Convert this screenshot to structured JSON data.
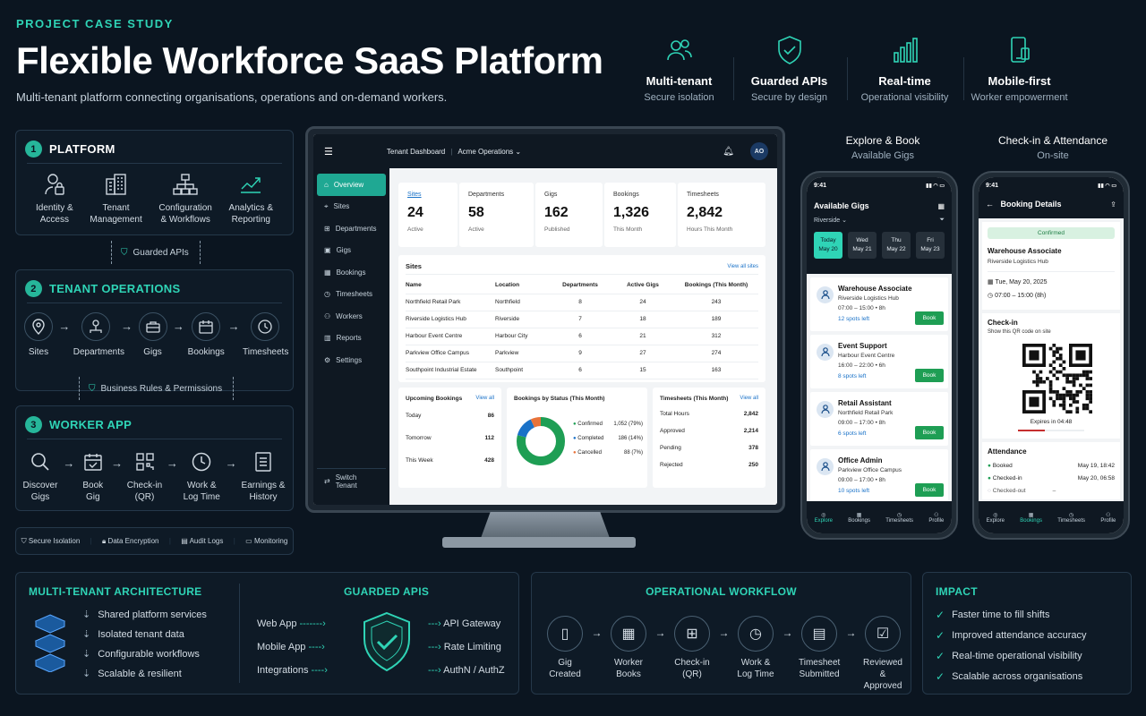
{
  "header": {
    "eyebrow": "PROJECT CASE STUDY",
    "title": "Flexible Workforce SaaS Platform",
    "subtitle": "Multi-tenant platform connecting organisations, operations and on-demand workers.",
    "features": [
      {
        "icon": "users-icon",
        "title": "Multi-tenant",
        "sub": "Secure isolation"
      },
      {
        "icon": "shield-check-icon",
        "title": "Guarded APIs",
        "sub": "Secure by design"
      },
      {
        "icon": "bar-chart-icon",
        "title": "Real-time",
        "sub": "Operational visibility"
      },
      {
        "icon": "mobile-icon",
        "title": "Mobile-first",
        "sub": "Worker empowerment"
      }
    ]
  },
  "platform": {
    "num": "1",
    "title": "PLATFORM",
    "items": [
      {
        "icon": "lock-user-icon",
        "l1": "Identity &",
        "l2": "Access"
      },
      {
        "icon": "building-icon",
        "l1": "Tenant",
        "l2": "Management"
      },
      {
        "icon": "workflow-icon",
        "l1": "Configuration",
        "l2": "& Workflows"
      },
      {
        "icon": "analytics-icon",
        "l1": "Analytics &",
        "l2": "Reporting"
      }
    ],
    "connector": "Guarded APIs"
  },
  "tenant_ops": {
    "num": "2",
    "title": "TENANT OPERATIONS",
    "items": [
      "Sites",
      "Departments",
      "Gigs",
      "Bookings",
      "Timesheets"
    ],
    "connector": "Business Rules & Permissions"
  },
  "worker_app": {
    "num": "3",
    "title": "WORKER APP",
    "items": [
      {
        "l1": "Discover",
        "l2": "Gigs"
      },
      {
        "l1": "Book",
        "l2": "Gig"
      },
      {
        "l1": "Check-in",
        "l2": "(QR)"
      },
      {
        "l1": "Work &",
        "l2": "Log Time"
      },
      {
        "l1": "Earnings &",
        "l2": "History"
      }
    ]
  },
  "security_bar": [
    "Secure Isolation",
    "Data Encryption",
    "Audit Logs",
    "Monitoring"
  ],
  "dashboard": {
    "topbar": {
      "title": "Tenant Dashboard",
      "tenant": "Acme Operations",
      "avatar": "AO"
    },
    "sidebar": [
      "Overview",
      "Sites",
      "Departments",
      "Gigs",
      "Bookings",
      "Timesheets",
      "Workers",
      "Reports",
      "Settings"
    ],
    "switch_tenant": "Switch Tenant",
    "kpis": [
      {
        "label": "Sites",
        "value": "24",
        "sub": "Active"
      },
      {
        "label": "Departments",
        "value": "58",
        "sub": "Active"
      },
      {
        "label": "Gigs",
        "value": "162",
        "sub": "Published"
      },
      {
        "label": "Bookings",
        "value": "1,326",
        "sub": "This Month"
      },
      {
        "label": "Timesheets",
        "value": "2,842",
        "sub": "Hours This Month"
      }
    ],
    "sites_table": {
      "title": "Sites",
      "link": "View all sites",
      "headers": [
        "Name",
        "Location",
        "Departments",
        "Active Gigs",
        "Bookings (This Month)"
      ],
      "rows": [
        [
          "Northfield Retail Park",
          "Northfield",
          "8",
          "24",
          "243"
        ],
        [
          "Riverside Logistics Hub",
          "Riverside",
          "7",
          "18",
          "189"
        ],
        [
          "Harbour Event Centre",
          "Harbour City",
          "6",
          "21",
          "312"
        ],
        [
          "Parkview Office Campus",
          "Parkview",
          "9",
          "27",
          "274"
        ],
        [
          "Southpoint Industrial Estate",
          "Southpoint",
          "6",
          "15",
          "163"
        ]
      ]
    },
    "upcoming": {
      "title": "Upcoming Bookings",
      "link": "View all",
      "rows": [
        [
          "Today",
          "86"
        ],
        [
          "Tomorrow",
          "112"
        ],
        [
          "This Week",
          "428"
        ]
      ]
    },
    "status": {
      "title": "Bookings by Status (This Month)",
      "items": [
        {
          "label": "Confirmed",
          "value": "1,052 (79%)",
          "pct": 79,
          "color": "#1e9e54"
        },
        {
          "label": "Completed",
          "value": "186 (14%)",
          "pct": 14,
          "color": "#1a72c8"
        },
        {
          "label": "Cancelled",
          "value": "88 (7%)",
          "pct": 7,
          "color": "#e8733a"
        }
      ]
    },
    "timesheets": {
      "title": "Timesheets (This Month)",
      "link": "View all",
      "rows": [
        [
          "Total Hours",
          "2,842"
        ],
        [
          "Approved",
          "2,214"
        ],
        [
          "Pending",
          "378"
        ],
        [
          "Rejected",
          "250"
        ]
      ]
    }
  },
  "phone1": {
    "caption": "Explore & Book",
    "caption_sub": "Available Gigs",
    "time": "9:41",
    "title": "Available Gigs",
    "filter": "Riverside",
    "dates": [
      [
        "Today",
        "May 20"
      ],
      [
        "Wed",
        "May 21"
      ],
      [
        "Thu",
        "May 22"
      ],
      [
        "Fri",
        "May 23"
      ]
    ],
    "gigs": [
      {
        "title": "Warehouse Associate",
        "site": "Riverside Logistics Hub",
        "time": "07:00 – 15:00 • 8h",
        "spots": "12 spots left",
        "icon": "worker-icon"
      },
      {
        "title": "Event Support",
        "site": "Harbour Event Centre",
        "time": "16:00 – 22:00 • 6h",
        "spots": "8 spots left",
        "icon": "worker-icon"
      },
      {
        "title": "Retail Assistant",
        "site": "Northfield Retail Park",
        "time": "09:00 – 17:00 • 8h",
        "spots": "6 spots left",
        "icon": "bag-icon"
      },
      {
        "title": "Office Admin",
        "site": "Parkview Office Campus",
        "time": "09:00 – 17:00 • 8h",
        "spots": "10 spots left",
        "icon": "worker-icon"
      }
    ],
    "book_label": "Book",
    "nav": [
      "Explore",
      "Bookings",
      "Timesheets",
      "Profile"
    ]
  },
  "phone2": {
    "caption": "Check-in & Attendance",
    "caption_sub": "On-site",
    "time": "9:41",
    "title": "Booking Details",
    "status": "Confirmed",
    "role": "Warehouse Associate",
    "site": "Riverside Logistics Hub",
    "date": "Tue, May 20, 2025",
    "hours": "07:00 – 15:00 (8h)",
    "checkin_title": "Check-in",
    "checkin_sub": "Show this QR code on site",
    "expires": "Expires in 04:48",
    "attendance_title": "Attendance",
    "attendance": [
      [
        "Booked",
        "May 19, 18:42"
      ],
      [
        "Checked-in",
        "May 20, 06:58"
      ],
      [
        "Checked-out",
        "–"
      ]
    ],
    "nav": [
      "Explore",
      "Bookings",
      "Timesheets",
      "Profile"
    ]
  },
  "bottom": {
    "arch": {
      "title": "MULTI-TENANT ARCHITECTURE",
      "items": [
        "Shared platform services",
        "Isolated tenant data",
        "Configurable workflows",
        "Scalable & resilient"
      ]
    },
    "apis": {
      "title": "GUARDED APIS",
      "left": [
        "Web App",
        "Mobile App",
        "Integrations"
      ],
      "right": [
        "API Gateway",
        "Rate Limiting",
        "AuthN / AuthZ"
      ]
    },
    "workflow": {
      "title": "OPERATIONAL WORKFLOW",
      "steps": [
        [
          "Gig",
          "Created"
        ],
        [
          "Worker",
          "Books"
        ],
        [
          "Check-in",
          "(QR)"
        ],
        [
          "Work &",
          "Log Time"
        ],
        [
          "Timesheet",
          "Submitted"
        ],
        [
          "Reviewed &",
          "Approved"
        ]
      ]
    },
    "impact": {
      "title": "IMPACT",
      "items": [
        "Faster time to fill shifts",
        "Improved attendance accuracy",
        "Real-time operational visibility",
        "Scalable across organisations"
      ]
    }
  },
  "colors": {
    "accent": "#2fd4b6",
    "bg": "#0b1520",
    "green": "#1e9e54",
    "blue": "#1a72c8",
    "orange": "#e8733a"
  }
}
